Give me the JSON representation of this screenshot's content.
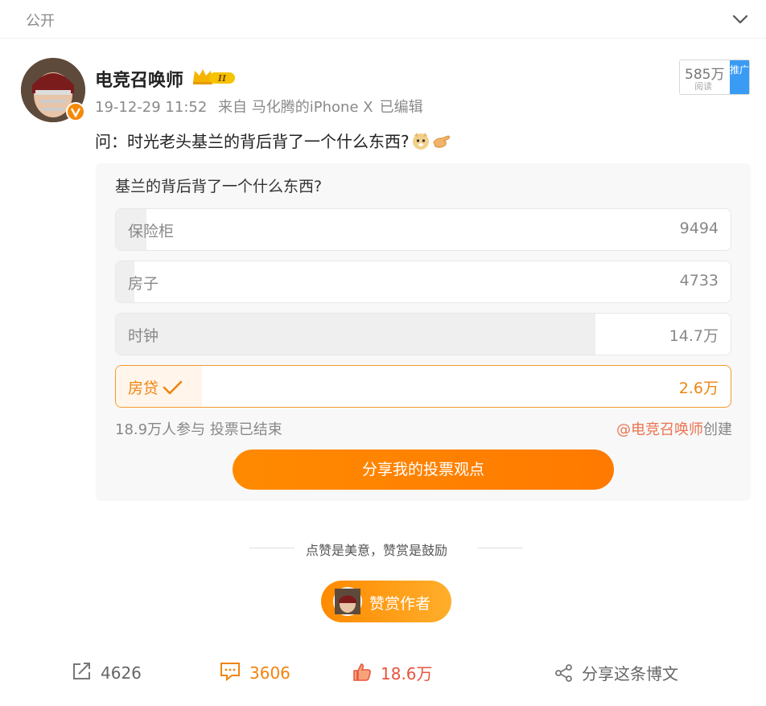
{
  "header": {
    "visibility": "公开"
  },
  "author": {
    "name": "电竞召唤师",
    "level_badge": "II",
    "timestamp": "19-12-29 11:52",
    "source": "来自 马化腾的iPhone X",
    "edited": "已编辑"
  },
  "read_count": {
    "value": "585万",
    "label": "阅读",
    "promote": "推广"
  },
  "post": {
    "text": "问：时光老头基兰的背后背了一个什么东西?"
  },
  "poll": {
    "question": "基兰的背后背了一个什么东西?",
    "options": [
      {
        "label": "保险柜",
        "count": "9494",
        "share": 0.05,
        "selected": false
      },
      {
        "label": "房子",
        "count": "4733",
        "share": 0.03,
        "selected": false
      },
      {
        "label": "时钟",
        "count": "14.7万",
        "share": 0.78,
        "selected": false
      },
      {
        "label": "房贷",
        "count": "2.6万",
        "share": 0.14,
        "selected": true
      }
    ],
    "participants": "18.9万人参与",
    "status": "投票已结束",
    "creator_at": "@电竞召唤师",
    "creator_suffix": "创建",
    "share_button": "分享我的投票观点"
  },
  "reward": {
    "slogan": "点赞是美意，赞赏是鼓励",
    "button": "赞赏作者"
  },
  "actions": {
    "repost": "4626",
    "comment": "3606",
    "like": "18.6万",
    "share": "分享这条博文"
  },
  "colors": {
    "accent": "#ff8200",
    "link": "#eb7350",
    "like": "#e8543c"
  }
}
